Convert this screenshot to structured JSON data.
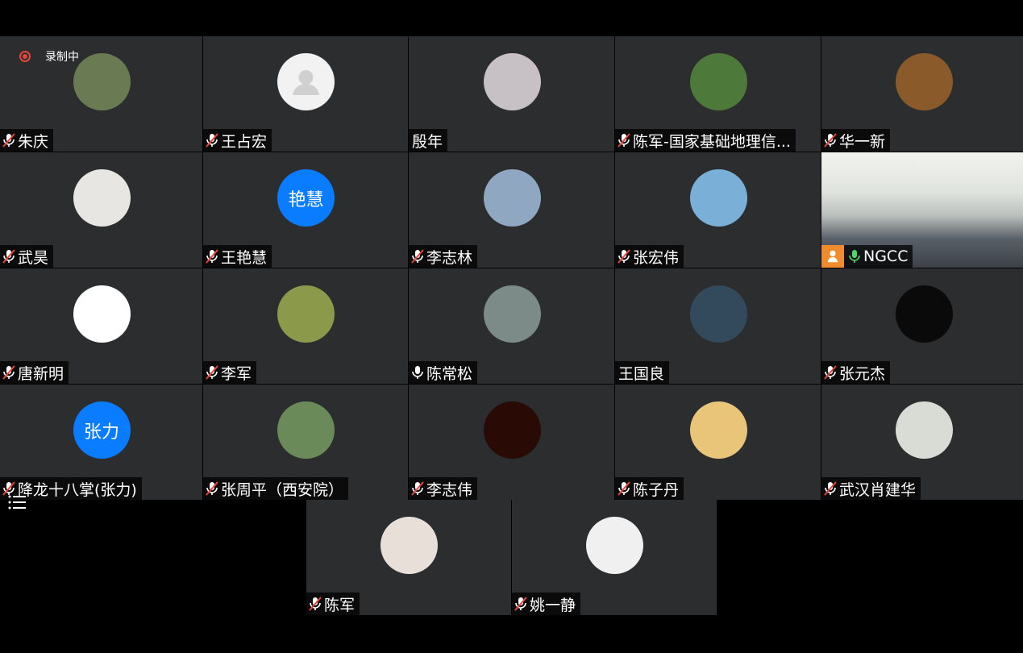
{
  "recording": {
    "label": "录制中"
  },
  "participants": [
    {
      "name": "朱庆",
      "muted": true,
      "avatar": "photo-man",
      "bg": "#6a7a52"
    },
    {
      "name": "王占宏",
      "muted": true,
      "avatar": "default-person",
      "bg": "#f2f2f2"
    },
    {
      "name": "殷年",
      "muted": null,
      "avatar": "photo-grapes",
      "bg": "#c7c0c5"
    },
    {
      "name": "陈军-国家基础地理信...",
      "muted": true,
      "avatar": "photo-flowers",
      "bg": "#4d7a3a"
    },
    {
      "name": "华一新",
      "muted": true,
      "avatar": "photo-autumn",
      "bg": "#8a5a2a"
    },
    {
      "name": "武昊",
      "muted": true,
      "avatar": "photo-squirrel",
      "bg": "#e8e6e2"
    },
    {
      "name": "王艳慧",
      "muted": true,
      "avatar": "text",
      "avatar_text": "艳慧",
      "bg": "#0a7cff"
    },
    {
      "name": "李志林",
      "muted": true,
      "avatar": "photo-mountain",
      "bg": "#8fa7c0"
    },
    {
      "name": "张宏伟",
      "muted": true,
      "avatar": "photo-jump",
      "bg": "#7ab0d8"
    },
    {
      "name": "NGCC",
      "muted": false,
      "avatar": "video",
      "bg": "#d9ddd8"
    },
    {
      "name": "唐新明",
      "muted": true,
      "avatar": "photo-cartoon",
      "bg": "#ffffff"
    },
    {
      "name": "李军",
      "muted": true,
      "avatar": "photo-hills",
      "bg": "#8b9a4a"
    },
    {
      "name": "陈常松",
      "muted": false,
      "avatar": "photo-cliff",
      "bg": "#7c8a88"
    },
    {
      "name": "王国良",
      "muted": null,
      "avatar": "photo-wave",
      "bg": "#33495c"
    },
    {
      "name": "张元杰",
      "muted": true,
      "avatar": "photo-moon",
      "bg": "#0a0a0a"
    },
    {
      "name": "降龙十八掌(张力)",
      "muted": true,
      "avatar": "text",
      "avatar_text": "张力",
      "bg": "#0a7cff"
    },
    {
      "name": "张周平（西安院）",
      "muted": true,
      "avatar": "photo-river",
      "bg": "#6a8a5a"
    },
    {
      "name": "李志伟",
      "muted": true,
      "avatar": "photo-fire",
      "bg": "#2a0a05"
    },
    {
      "name": "陈子丹",
      "muted": true,
      "avatar": "photo-ox",
      "bg": "#e9c57a"
    },
    {
      "name": "武汉肖建华",
      "muted": true,
      "avatar": "photo-daffodil",
      "bg": "#d8dcd5"
    }
  ],
  "bottom_participants": [
    {
      "name": "陈军",
      "muted": true,
      "avatar": "photo-woman1",
      "bg": "#e8e0d8"
    },
    {
      "name": "姚一静",
      "muted": true,
      "avatar": "photo-woman2",
      "bg": "#f0f0f0"
    }
  ]
}
